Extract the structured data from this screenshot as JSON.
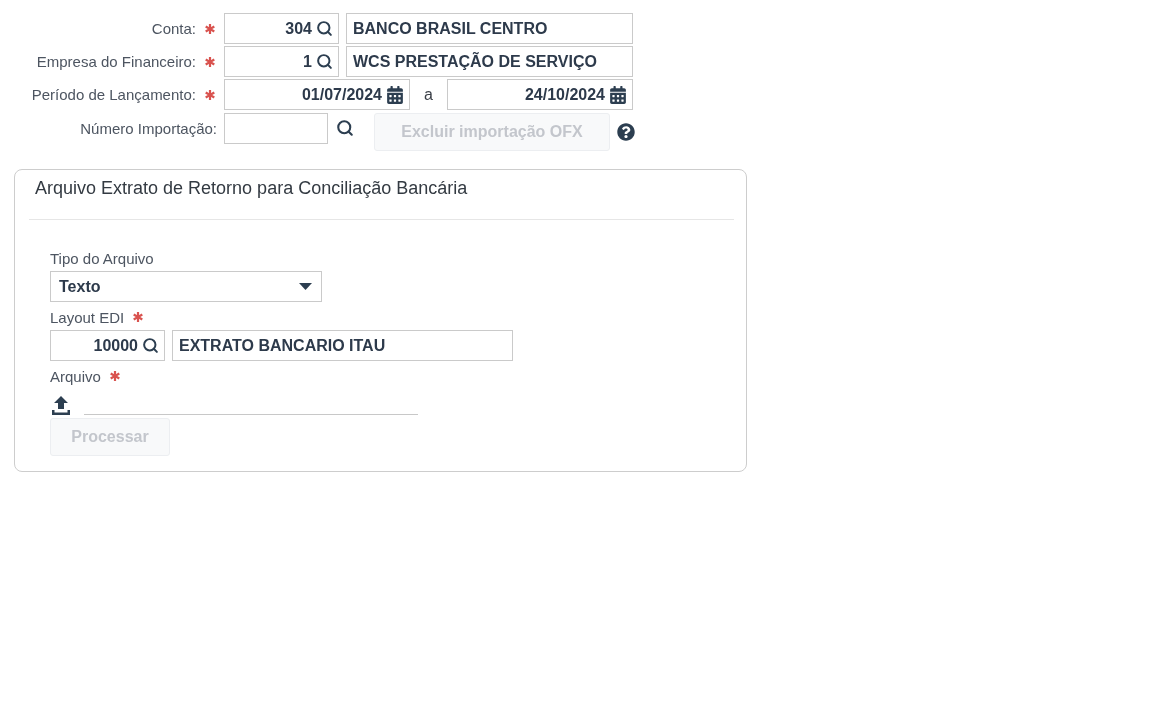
{
  "filters": {
    "fields": [
      {
        "kind": "lookup",
        "label": "Conta:",
        "required": true,
        "code": "304",
        "name": "BANCO BRASIL CENTRO"
      },
      {
        "kind": "lookup",
        "label": "Empresa do Financeiro:",
        "required": true,
        "code": "1",
        "name": "WCS PRESTAÇÃO DE SERVIÇO"
      },
      {
        "kind": "date_range",
        "label": "Período de Lançamento:",
        "required": true,
        "from": "01/07/2024",
        "separator": "a",
        "to": "24/10/2024"
      },
      {
        "kind": "search",
        "label": "Número Importação:",
        "required": false,
        "button": {
          "label": "Excluir importação OFX",
          "disabled": true
        }
      }
    ]
  },
  "panel": {
    "title": "Arquivo Extrato de Retorno para Conciliação Bancária",
    "fields": [
      {
        "kind": "select",
        "label": "Tipo do Arquivo",
        "required": false,
        "value": "Texto"
      },
      {
        "kind": "lookup",
        "label": "Layout EDI",
        "required": true,
        "code": "10000",
        "name": "EXTRATO BANCARIO ITAU"
      },
      {
        "kind": "file",
        "label": "Arquivo",
        "required": true
      }
    ],
    "button": {
      "label": "Processar",
      "disabled": true
    }
  }
}
